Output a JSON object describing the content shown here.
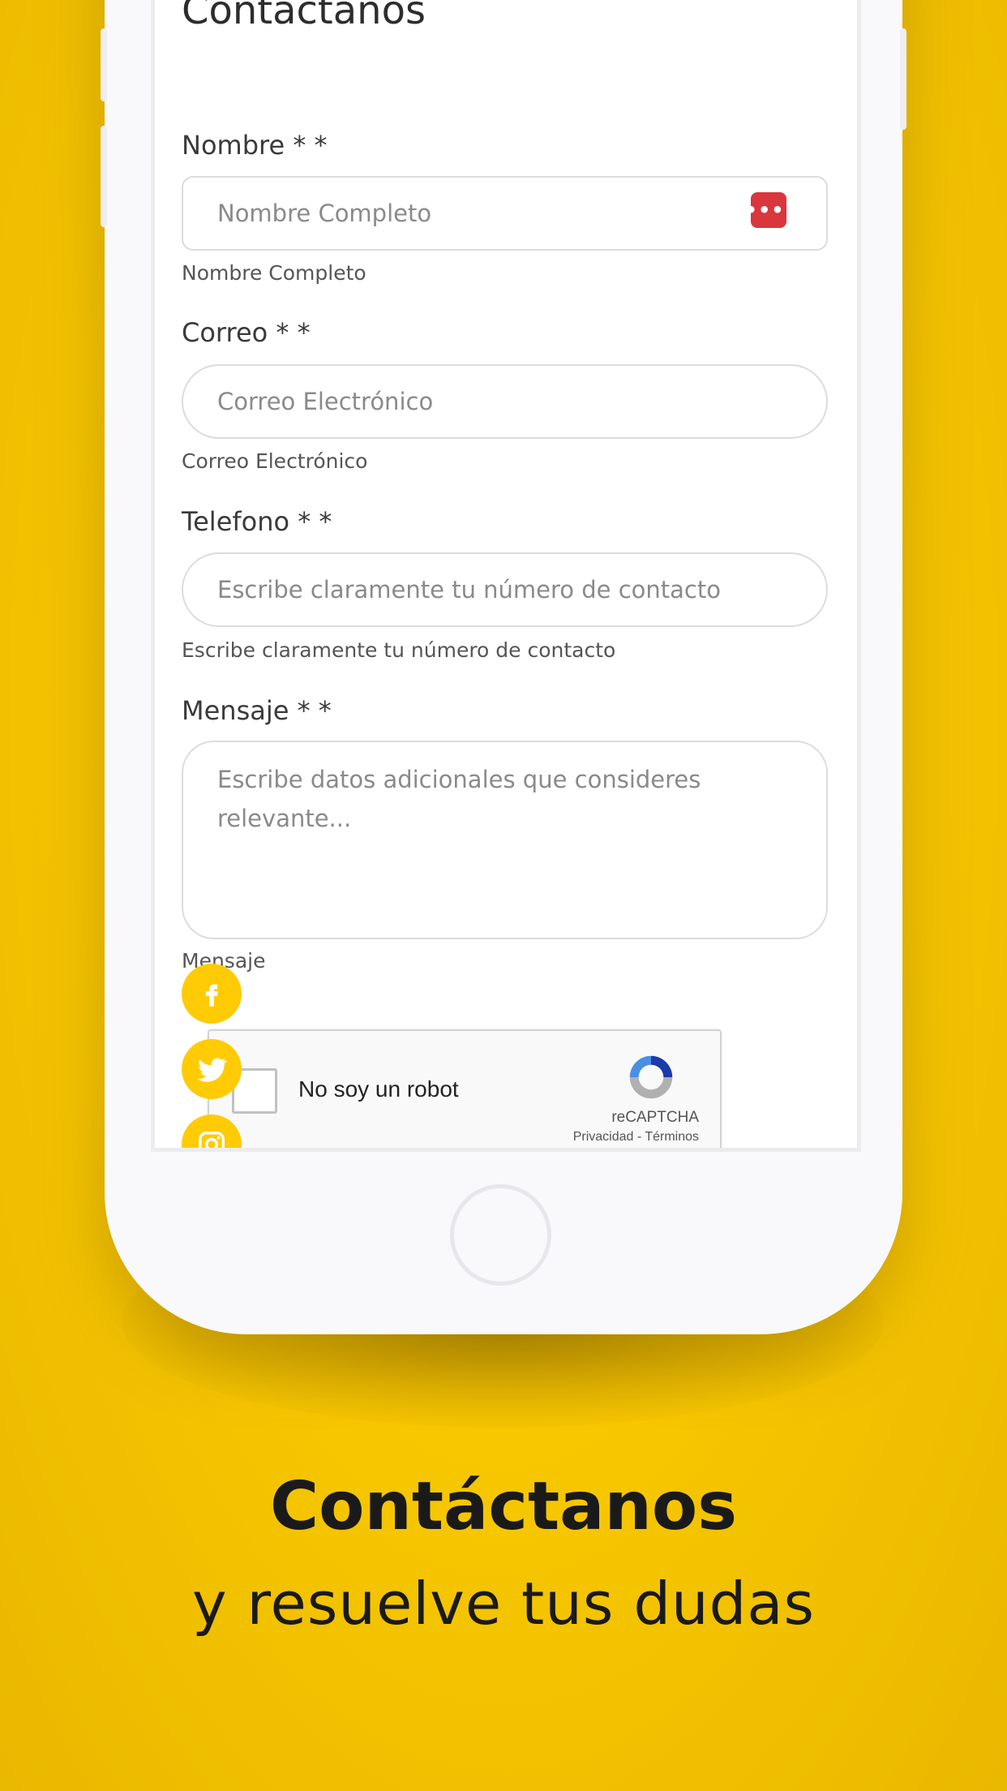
{
  "screen": {
    "title": "Contactanos",
    "fields": {
      "name": {
        "label": "Nombre * *",
        "placeholder": "Nombre Completo",
        "help": "Nombre Completo"
      },
      "email": {
        "label": "Correo * *",
        "placeholder": "Correo Electrónico",
        "help": "Correo Electrónico"
      },
      "phone": {
        "label": "Telefono * *",
        "placeholder": "Escribe claramente tu número de contacto",
        "help": "Escribe claramente tu número de contacto"
      },
      "message": {
        "label": "Mensaje * *",
        "placeholder": "Escribe datos adicionales que consideres relevante...",
        "help": "Mensaje"
      }
    },
    "password_manager_icon": "•••|",
    "recaptcha": {
      "label": "No soy un robot",
      "brand": "reCAPTCHA",
      "links": "Privacidad - Términos"
    },
    "social": [
      "facebook-icon",
      "twitter-icon",
      "instagram-icon"
    ]
  },
  "promo": {
    "headline": "Contáctanos",
    "subline": "y resuelve tus dudas"
  },
  "colors": {
    "background": "#f8c800",
    "accent": "#ffcb05",
    "alert_red": "#d9363e",
    "text_dark": "#1a1a1a"
  }
}
